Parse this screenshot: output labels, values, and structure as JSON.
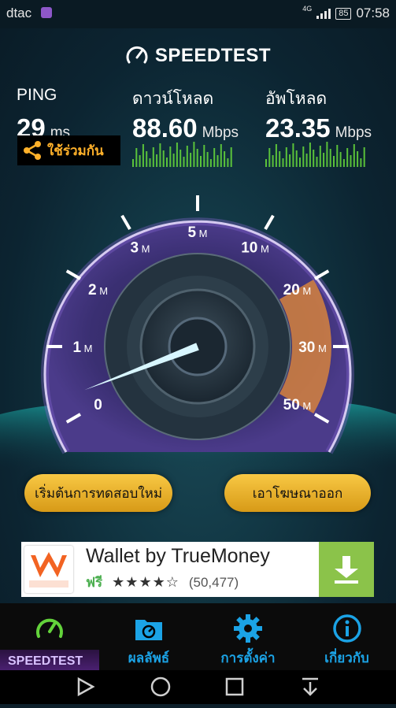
{
  "status_bar": {
    "carrier": "dtac",
    "network": "4G",
    "battery": "85",
    "time": "07:58"
  },
  "header": {
    "title": "SPEEDTEST"
  },
  "metrics": {
    "ping": {
      "label": "PING",
      "value": "29",
      "unit": "ms"
    },
    "download": {
      "label": "ดาวน์โหลด",
      "value": "88.60",
      "unit": "Mbps"
    },
    "upload": {
      "label": "อัพโหลด",
      "value": "23.35",
      "unit": "Mbps"
    }
  },
  "share": {
    "label": "ใช้ร่วมกัน"
  },
  "gauge": {
    "ticks": [
      "0",
      "1M",
      "2M",
      "3M",
      "5M",
      "10M",
      "20M",
      "30M",
      "50M"
    ],
    "needle_value_mbps": 0.3
  },
  "buttons": {
    "restart": "เริ่มต้นการทดสอบใหม่",
    "remove_ads": "เอาโฆษณาออก"
  },
  "ad": {
    "title": "Wallet by TrueMoney",
    "price": "ฟรี",
    "rating": 4.5,
    "rating_stars": "★★★★☆",
    "reviews": "(50,477)",
    "icon_brand": "truemoney"
  },
  "tabs": [
    {
      "label": "SPEEDTEST",
      "icon": "speedometer-icon",
      "active": true
    },
    {
      "label": "ผลลัพธ์",
      "icon": "results-folder-icon",
      "active": false
    },
    {
      "label": "การตั้งค่า",
      "icon": "gear-icon",
      "active": false
    },
    {
      "label": "เกี่ยวกับ",
      "icon": "info-icon",
      "active": false
    }
  ],
  "colors": {
    "accent_blue": "#1ba3e6",
    "green": "#63d33b",
    "orange": "#f4a12a",
    "gauge_purple": "#8a67d8"
  }
}
